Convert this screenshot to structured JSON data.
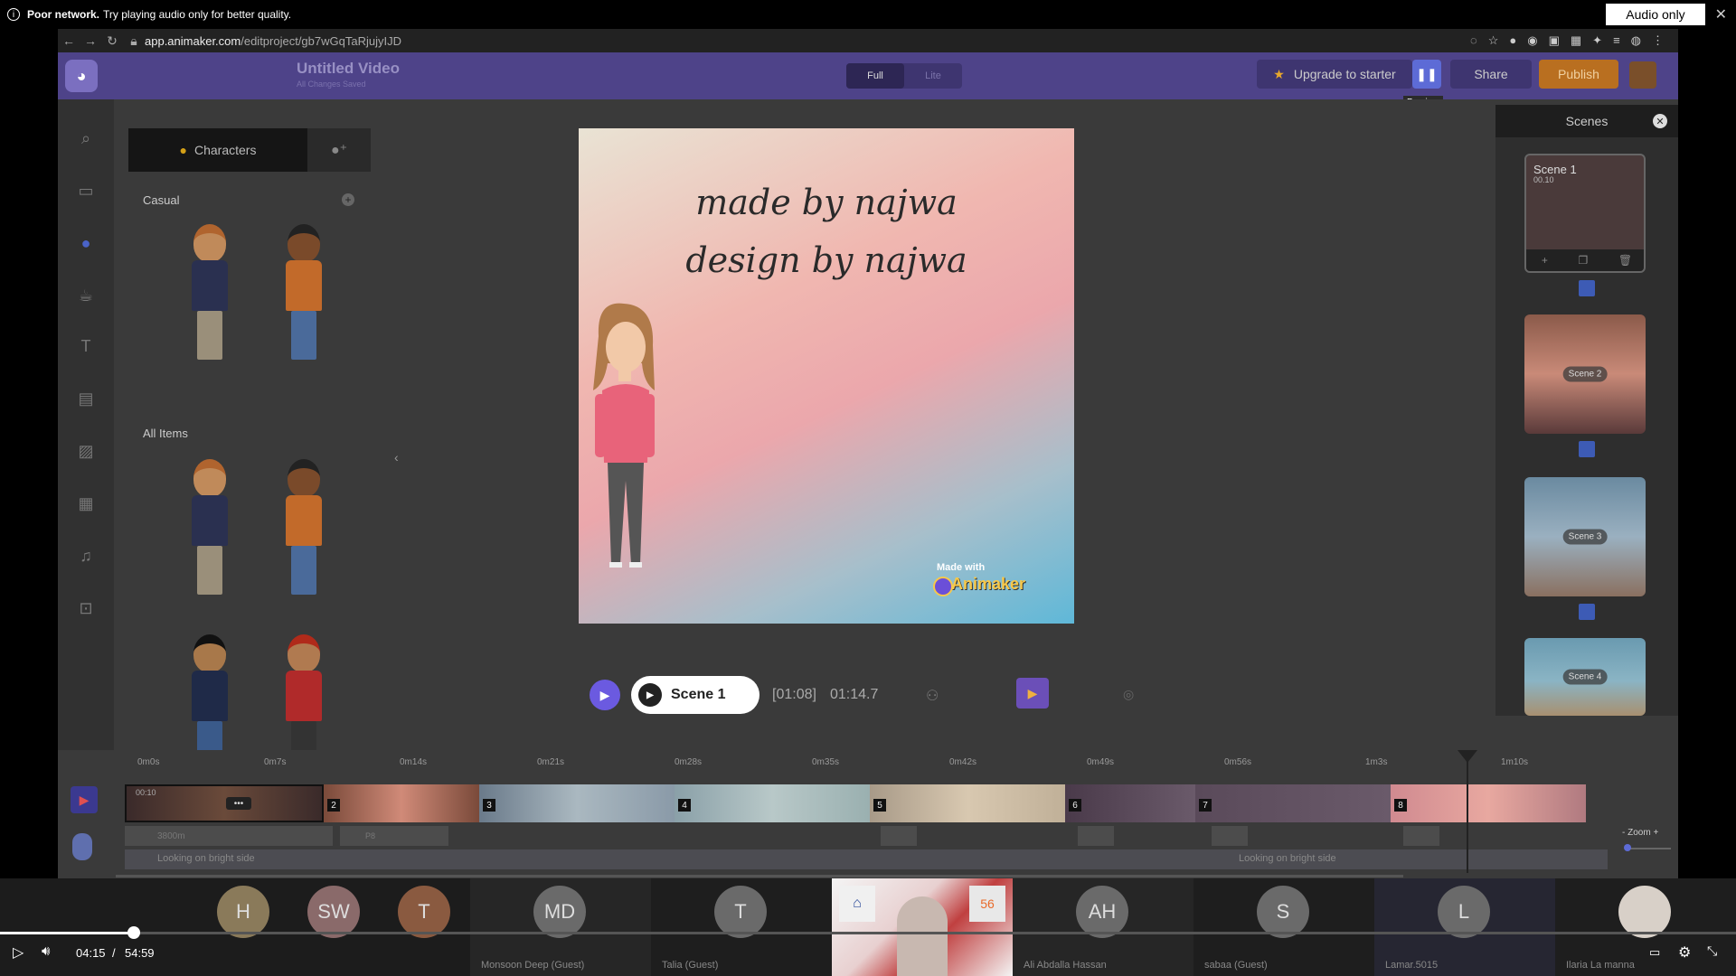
{
  "notification": {
    "bold": "Poor network.",
    "message": "Try playing audio only for better quality.",
    "audio_only": "Audio only"
  },
  "browser": {
    "url_host": "app.animaker.com",
    "url_path": "/editproject/gb7wGqTaRjujyIJD"
  },
  "app": {
    "title": "Untitled Video",
    "subtitle": "All Changes Saved",
    "mode_full": "Full",
    "mode_lite": "Lite",
    "upgrade": "Upgrade to starter",
    "preview_tip": "Preview",
    "share": "Share",
    "publish": "Publish"
  },
  "library": {
    "tab_characters": "Characters",
    "category_casual": "Casual",
    "category_all": "All Items"
  },
  "canvas": {
    "line1": "made by najwa",
    "line2": "design by najwa",
    "made_with": "Made with",
    "brand": "Animaker"
  },
  "playback": {
    "scene_name": "Scene 1",
    "timecode_bracket": "[01:08]",
    "timecode": "01:14.7"
  },
  "scenes": {
    "header": "Scenes",
    "items": [
      {
        "label": "Scene 1",
        "duration": "00.10"
      },
      {
        "label": "Scene 2"
      },
      {
        "label": "Scene 3"
      },
      {
        "label": "Scene 4"
      }
    ]
  },
  "timeline": {
    "ticks": [
      "0m0s",
      "0m7s",
      "0m14s",
      "0m21s",
      "0m28s",
      "0m35s",
      "0m42s",
      "0m49s",
      "0m56s",
      "1m3s",
      "1m10s"
    ],
    "clip1_time": "00:10",
    "clip_numbers": [
      "2",
      "3",
      "4",
      "5",
      "6",
      "7",
      "8"
    ],
    "track_label_a": "3800m",
    "track_label_b": "P8",
    "audio_label_1": "Looking on bright side",
    "audio_label_2": "Looking on bright side",
    "zoom": "Zoom"
  },
  "participants": [
    {
      "initials": "H",
      "name": ""
    },
    {
      "initials": "SW",
      "name": ""
    },
    {
      "initials": "T",
      "name": ""
    },
    {
      "initials": "MD",
      "name": "Monsoon Deep (Guest)"
    },
    {
      "initials": "T",
      "name": "Talia (Guest)"
    },
    {
      "initials": "",
      "name": ""
    },
    {
      "initials": "AH",
      "name": "Ali Abdalla Hassan"
    },
    {
      "initials": "S",
      "name": "sabaa (Guest)"
    },
    {
      "initials": "L",
      "name": "Lamar.5015"
    },
    {
      "initials": "",
      "name": "Ilaria La manna"
    }
  ],
  "player": {
    "time_current": "04:15",
    "time_separator": "/",
    "time_total": "54:59",
    "progress_fraction": 0.077
  },
  "colors": {
    "app_header": "#4e4389",
    "publish": "#b96f20",
    "accent": "#5d6bd6"
  }
}
